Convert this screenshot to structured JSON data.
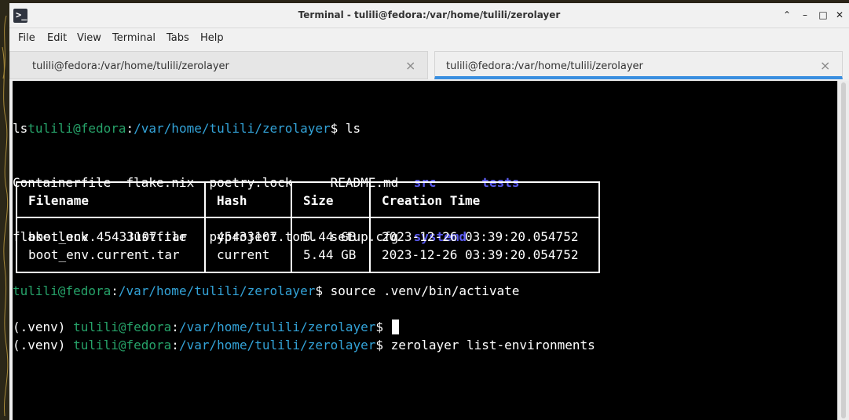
{
  "window": {
    "title": "Terminal - tulili@fedora:/var/home/tulili/zerolayer",
    "icon": "terminal-icon",
    "controls": [
      "chevron-up-icon",
      "minimize-icon",
      "maximize-icon",
      "close-icon"
    ]
  },
  "menubar": {
    "items": [
      "File",
      "Edit",
      "View",
      "Terminal",
      "Tabs",
      "Help"
    ]
  },
  "tabs": [
    {
      "label": "tulili@fedora:/var/home/tulili/zerolayer",
      "active": false
    },
    {
      "label": "tulili@fedora:/var/home/tulili/zerolayer",
      "active": true
    }
  ],
  "terminal": {
    "prompt_user": "tulili@fedora",
    "prompt_sep": ":",
    "prompt_path": "/var/home/tulili/zerolayer",
    "prompt_end": "$ ",
    "venv": "(.venv) ",
    "line1_prefix": "ls",
    "cmd1": "ls",
    "ls_files": [
      [
        "Containerfile  ",
        "flake.nix  ",
        "poetry.lock     ",
        "README.md  "
      ],
      [
        "flake.lock     ",
        "Justfile   ",
        "pyproject.toml  ",
        "setup.cfg  "
      ]
    ],
    "ls_dirs": [
      [
        "src      ",
        "tests"
      ],
      [
        "systemd"
      ]
    ],
    "cmd2": "source .venv/bin/activate",
    "cmd3": "zerolayer list-environments"
  },
  "environments_table": {
    "headers": [
      "Filename",
      "Hash",
      "Size",
      "Creation Time"
    ],
    "rows": [
      [
        "boot_env.45433107.tar",
        "45433107",
        "5.44 GB",
        "2023-12-26 03:39:20.054752"
      ],
      [
        "boot_env.current.tar",
        "current",
        "5.44 GB",
        "2023-12-26 03:39:20.054752"
      ]
    ]
  },
  "colors": {
    "terminal_bg": "#000000",
    "prompt_green": "#26a269",
    "dir_blue": "#5b5bf0",
    "tab_accent": "#3a8fe0"
  }
}
